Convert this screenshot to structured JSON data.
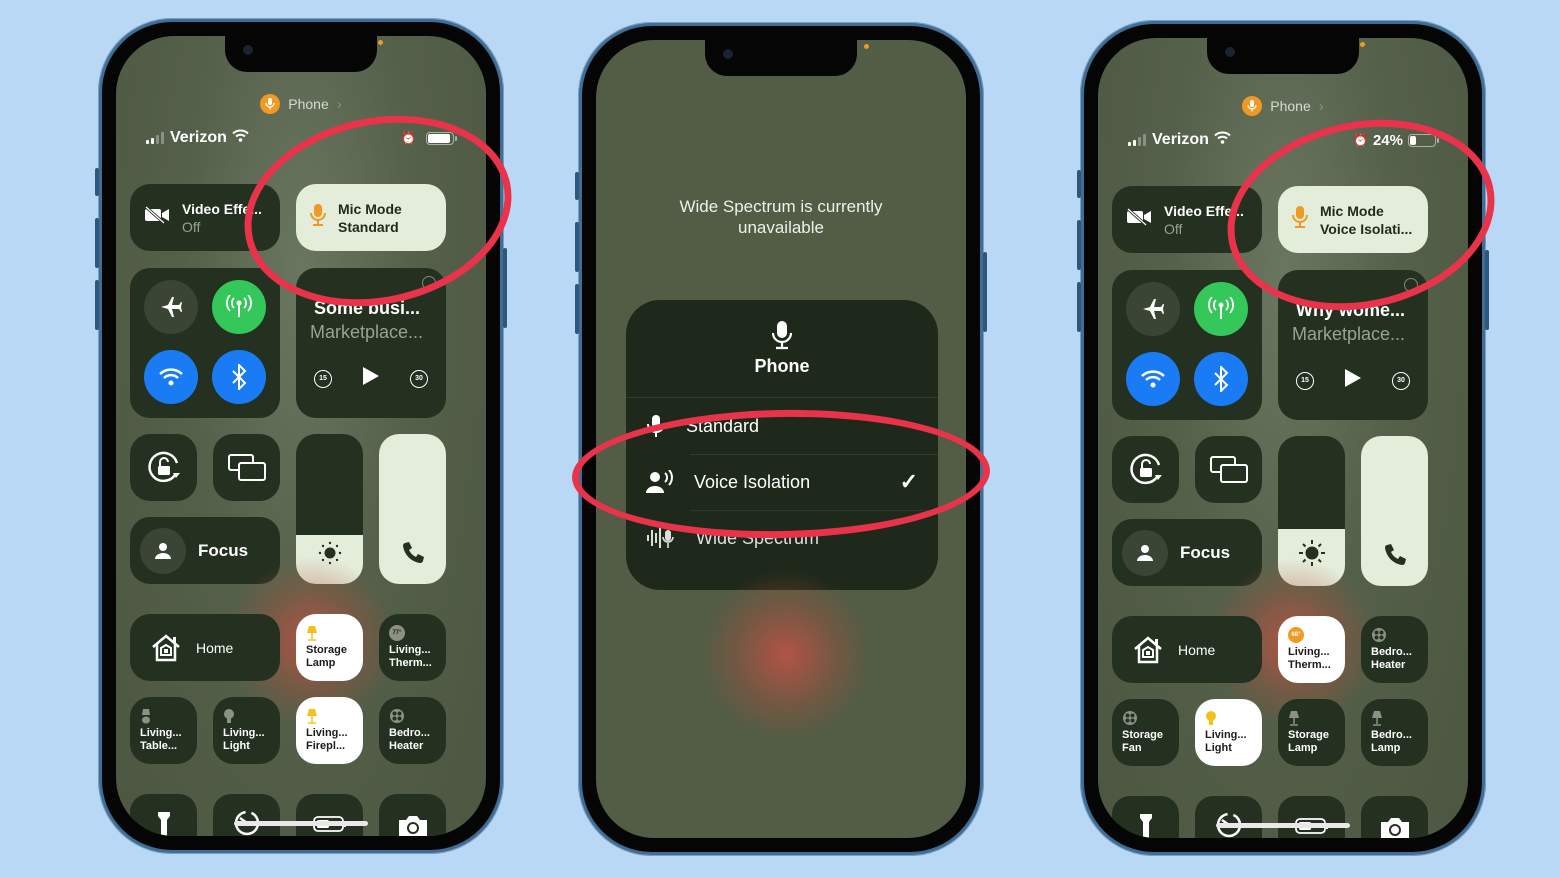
{
  "colors": {
    "background": "#b9d8f6",
    "accent_orange": "#f09a24",
    "cellular_green": "#34c759",
    "toggle_blue": "#1a7cf5",
    "annotation_red": "#e8334a"
  },
  "phones": [
    {
      "mic_indicator": {
        "app": "Phone",
        "icon": "microphone-icon"
      },
      "status": {
        "carrier": "Verizon",
        "battery_text": "",
        "battery_fraction": 0.9
      },
      "video_effects": {
        "title": "Video Effe...",
        "value": "Off"
      },
      "mic_mode": {
        "title": "Mic Mode",
        "value": "Standard"
      },
      "connectivity": {
        "airplane": false,
        "cellular": true,
        "wifi": true,
        "bluetooth": true
      },
      "now_playing": {
        "title": "Some busi...",
        "subtitle": "Marketplace...",
        "skip_back": "15",
        "skip_forward": "30"
      },
      "focus_label": "Focus",
      "brightness_level": 0.33,
      "volume_level": 1.0,
      "home_label": "Home",
      "accessories": [
        {
          "line1": "Storage",
          "line2": "Lamp",
          "icon": "lamp-icon",
          "on": true
        },
        {
          "line1": "Living...",
          "line2": "Therm...",
          "icon": "thermostat-icon",
          "temp": "77°",
          "on": false
        },
        {
          "line1": "Living...",
          "line2": "Table...",
          "icon": "table-lamp-icon",
          "on": false
        },
        {
          "line1": "Living...",
          "line2": "Light",
          "icon": "bulb-icon",
          "on": false
        },
        {
          "line1": "Living...",
          "line2": "Firepl...",
          "icon": "lamp-icon",
          "on": true
        },
        {
          "line1": "Bedro...",
          "line2": "Heater",
          "icon": "heater-icon",
          "on": false
        }
      ]
    },
    {
      "message": "Wide Spectrum is currently unavailable",
      "menu": {
        "title": "Phone",
        "items": [
          {
            "label": "Standard",
            "icon": "microphone-icon",
            "selected": false
          },
          {
            "label": "Voice Isolation",
            "icon": "voice-isolation-icon",
            "selected": true
          },
          {
            "label": "Wide Spectrum",
            "icon": "wide-spectrum-icon",
            "selected": false
          }
        ],
        "checkmark": "✓"
      }
    },
    {
      "mic_indicator": {
        "app": "Phone",
        "icon": "microphone-icon"
      },
      "status": {
        "carrier": "Verizon",
        "battery_text": "24%",
        "battery_fraction": 0.24
      },
      "video_effects": {
        "title": "Video Effe...",
        "value": "Off"
      },
      "mic_mode": {
        "title": "Mic Mode",
        "value": "Voice Isolati..."
      },
      "connectivity": {
        "airplane": false,
        "cellular": true,
        "wifi": true,
        "bluetooth": true
      },
      "now_playing": {
        "title": "Why wome...",
        "subtitle": "Marketplace...",
        "skip_back": "15",
        "skip_forward": "30"
      },
      "focus_label": "Focus",
      "brightness_level": 0.38,
      "volume_level": 1.0,
      "home_label": "Home",
      "accessories": [
        {
          "line1": "Living...",
          "line2": "Therm...",
          "icon": "thermostat-icon",
          "temp": "68°",
          "on": true
        },
        {
          "line1": "Bedro...",
          "line2": "Heater",
          "icon": "heater-icon",
          "on": false
        },
        {
          "line1": "Storage",
          "line2": "Fan",
          "icon": "fan-icon",
          "on": false
        },
        {
          "line1": "Living...",
          "line2": "Light",
          "icon": "bulb-icon",
          "on": true
        },
        {
          "line1": "Storage",
          "line2": "Lamp",
          "icon": "lamp-icon",
          "on": false
        },
        {
          "line1": "Bedro...",
          "line2": "Lamp",
          "icon": "lamp-icon",
          "on": false
        }
      ]
    }
  ]
}
